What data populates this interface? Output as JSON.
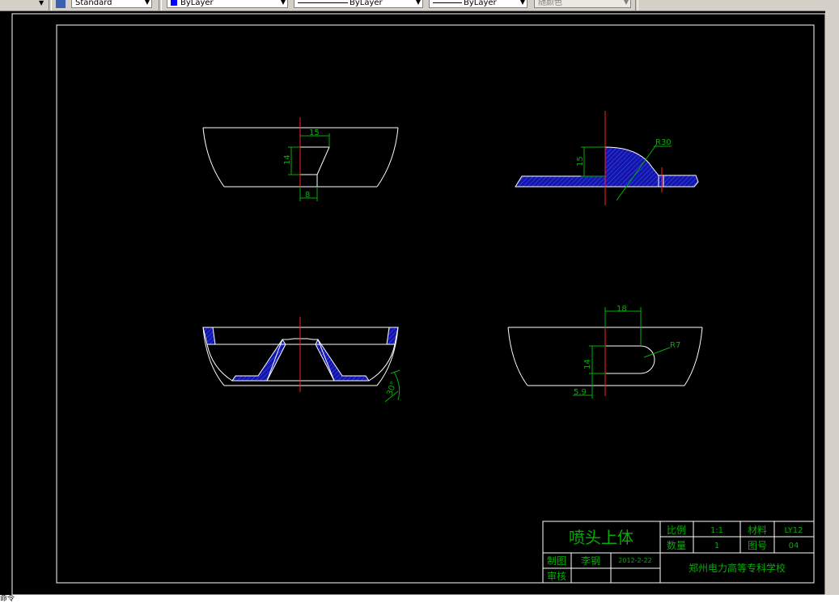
{
  "toolbar": {
    "text_style": "Standard",
    "layer": "ByLayer",
    "linetype": "ByLayer",
    "lineweight": "ByLayer",
    "plot_color": "随颜色"
  },
  "drawing": {
    "dimensions": {
      "d15_top_left": "15",
      "d14_top_left": "14",
      "d8": "8",
      "d15_top_right": "15",
      "r30": "R30",
      "d18": "18",
      "r7": "R7",
      "d14_bottom_right": "14",
      "d59": "5.9",
      "a30": "30°"
    },
    "title_block": {
      "part_name": "喷头上体",
      "scale_label": "比例",
      "scale_value": "1:1",
      "material_label": "材料",
      "material_value": "LY12",
      "qty_label": "数量",
      "qty_value": "1",
      "drawing_no_label": "图号",
      "drawing_no_value": "04",
      "drawn_by_label": "制图",
      "drawn_by_value": "李钢",
      "date": "2012-2-22",
      "checked_label": "审核",
      "school": "郑州电力高等专科学校"
    }
  },
  "colors": {
    "line": "#ffffff",
    "dimension": "#00b000",
    "centerline": "#ff2020",
    "hatch": "#1414a8",
    "background": "#000000"
  },
  "command": {
    "prompt": "命令"
  }
}
